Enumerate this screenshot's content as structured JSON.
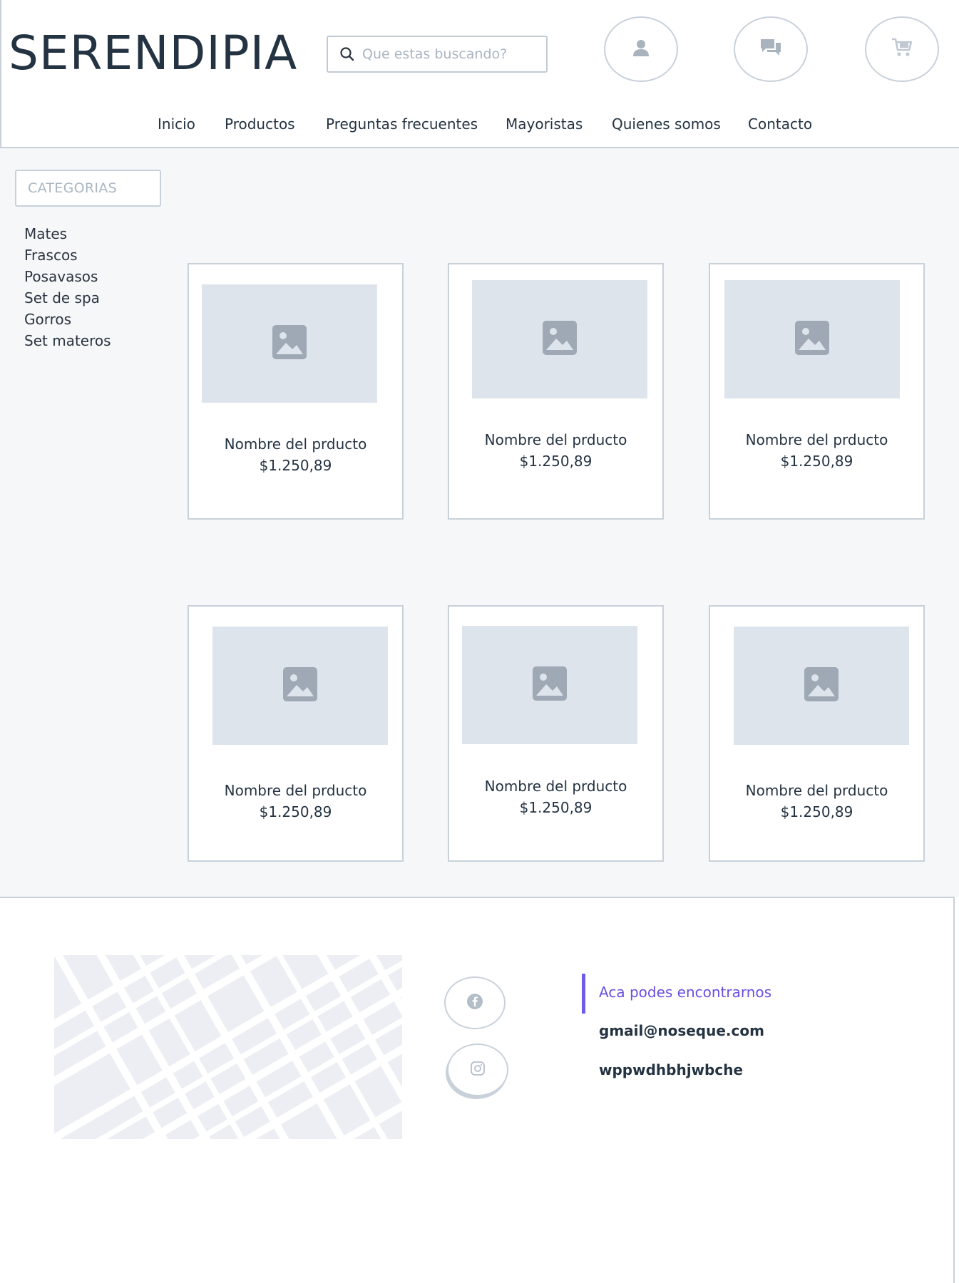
{
  "header": {
    "logo": "SERENDIPIA",
    "search": {
      "placeholder": "Que estas buscando?",
      "value": ""
    },
    "icons": [
      "user-icon",
      "chat-icon",
      "cart-icon"
    ]
  },
  "nav": {
    "items": [
      {
        "label": "Inicio"
      },
      {
        "label": "Productos"
      },
      {
        "label": "Preguntas frecuentes"
      },
      {
        "label": "Mayoristas"
      },
      {
        "label": "Quienes somos"
      },
      {
        "label": "Contacto"
      }
    ]
  },
  "sidebar": {
    "title": "CATEGORIAS",
    "categories": [
      "Mates",
      "Frascos",
      "Posavasos",
      "Set de spa",
      "Gorros",
      "Set materos"
    ]
  },
  "products": [
    {
      "name": "Nombre del prducto",
      "price": "$1.250,89"
    },
    {
      "name": "Nombre del prducto",
      "price": "$1.250,89"
    },
    {
      "name": "Nombre del prducto",
      "price": "$1.250,89"
    },
    {
      "name": "Nombre del prducto",
      "price": "$1.250,89"
    },
    {
      "name": "Nombre del prducto",
      "price": "$1.250,89"
    },
    {
      "name": "Nombre del prducto",
      "price": "$1.250,89"
    }
  ],
  "footer": {
    "social": [
      "facebook-icon",
      "instagram-icon"
    ],
    "contact_title": "Aca podes encontrarnos",
    "email": "gmail@noseque.com",
    "phone": "wppwdhbhjwbche"
  },
  "colors": {
    "accent": "#6c5ce7",
    "border": "#c8d1da",
    "text": "#243342",
    "placeholder_bg": "#dee4eb",
    "page_bg": "#f5f7f9"
  }
}
